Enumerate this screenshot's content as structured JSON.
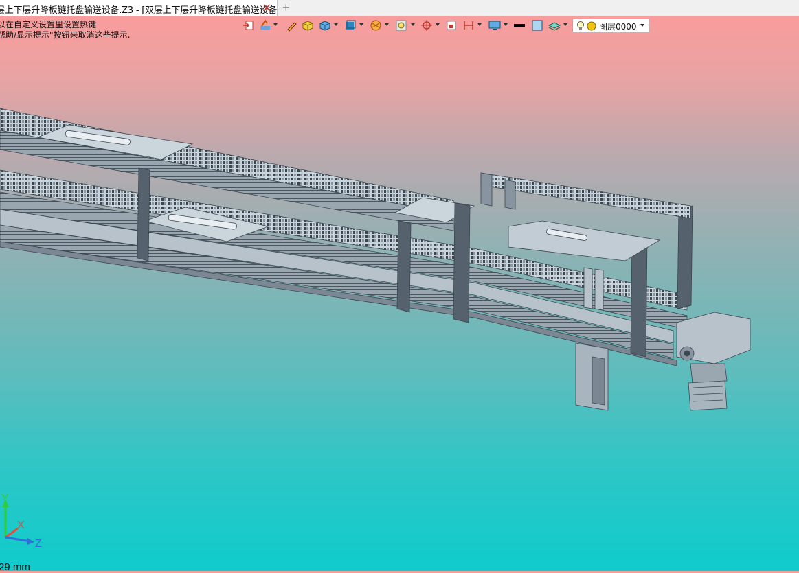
{
  "tab": {
    "title": "层上下层升降板链托盘输送设备.Z3 - [双层上下层升降板链托盘输送设备]",
    "close_icon": "close-icon",
    "add_icon": "plus-icon"
  },
  "hints": [
    "以在自定义设置里设置热键",
    "帮助/显示提示\"按钮来取消这些提示."
  ],
  "toolbar": {
    "icons": [
      "import-icon",
      "sketch-tool-icon",
      "pen-icon",
      "solid-box-icon",
      "cube-shaded-icon",
      "view-cube-icon",
      "render-style-icon",
      "viewport-icon",
      "snap-target-icon",
      "frame-icon",
      "dimension-icon",
      "display-settings-icon",
      "line-weight-icon",
      "color-swatch-icon",
      "layer-stack-icon"
    ],
    "layer": {
      "value": "图层0000",
      "icons": [
        "lightbulb-icon",
        "layer-color-icon"
      ]
    }
  },
  "axis": {
    "y": "Y",
    "x": "X",
    "z": "Z"
  },
  "scale_text": "29 mm",
  "colors": {
    "bg_top": "#fd9a9a",
    "bg_bottom": "#0fcccc",
    "model": "#b7c2cb",
    "model_dark": "#3b4650"
  }
}
